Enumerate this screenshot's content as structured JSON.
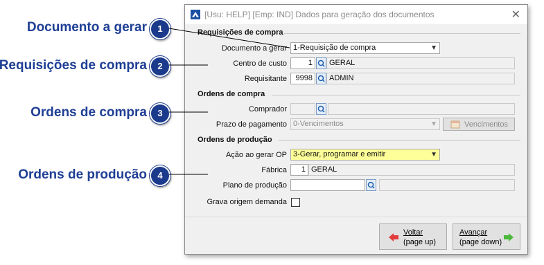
{
  "callouts": [
    {
      "number": "1",
      "label": "Documento a gerar"
    },
    {
      "number": "2",
      "label": "Requisições de compra"
    },
    {
      "number": "3",
      "label": "Ordens de compra"
    },
    {
      "number": "4",
      "label": "Ordens de produção"
    }
  ],
  "window": {
    "title": "[Usu: HELP] [Emp: IND] Dados para geração dos documentos",
    "close_label": "✕"
  },
  "requisicoes": {
    "section_title": "Requisições de compra",
    "documento_label": "Documento a gerar",
    "documento_value": "1-Requisição de compra",
    "centro_label": "Centro de custo",
    "centro_code": "1",
    "centro_name": "GERAL",
    "requisitante_label": "Requisitante",
    "requisitante_code": "9998",
    "requisitante_name": "ADMIN"
  },
  "ordens_compra": {
    "section_title": "Ordens de compra",
    "comprador_label": "Comprador",
    "comprador_code": "",
    "comprador_name": "",
    "prazo_label": "Prazo de pagamento",
    "prazo_value": "0-Vencimentos",
    "vencimentos_button": "Vencimentos"
  },
  "ordens_producao": {
    "section_title": "Ordens de produção",
    "acao_label": "Ação ao gerar OP",
    "acao_value": "3-Gerar, programar e emitir",
    "fabrica_label": "Fábrica",
    "fabrica_code": "1",
    "fabrica_name": "GERAL",
    "plano_label": "Plano de produção",
    "plano_code": "",
    "plano_name": "",
    "grava_label": "Grava origem demanda"
  },
  "buttons": {
    "voltar_line1": "Voltar",
    "voltar_line2": "(page up)",
    "avancar_line1": "Avançar",
    "avancar_line2": "(page down)"
  },
  "colors": {
    "callout_text": "#1f3f95",
    "badge": "#1b3a8c",
    "highlight_field": "#ffff99",
    "arrow_back": "#e23b3b",
    "arrow_forward": "#4cb83a"
  }
}
